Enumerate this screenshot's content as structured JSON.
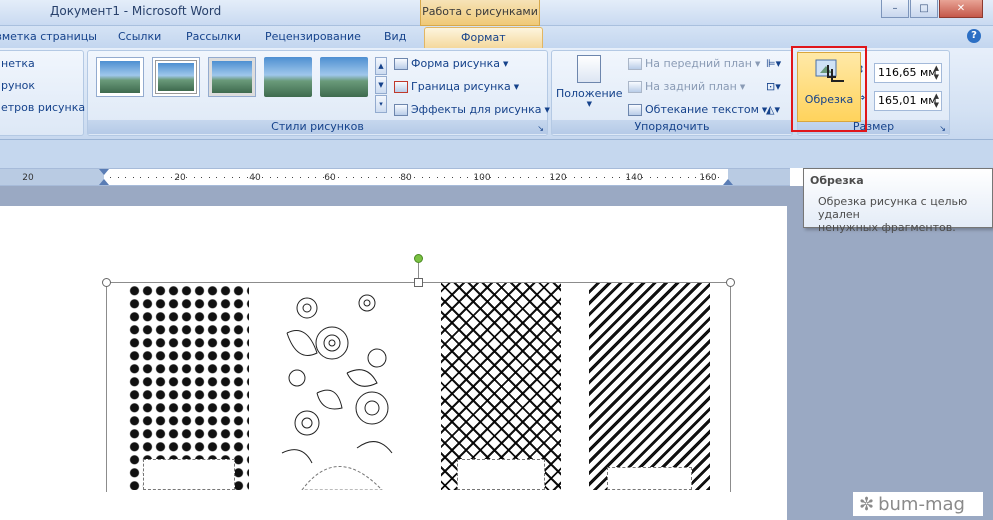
{
  "titlebar": {
    "title": "Документ1 - Microsoft Word",
    "context_tab": "Работа с рисунками",
    "minimize": "–",
    "maximize": "□",
    "close": "✕"
  },
  "tabs": {
    "items": [
      "зметка страницы",
      "Ссылки",
      "Рассылки",
      "Рецензирование",
      "Вид"
    ],
    "active": "Формат",
    "help": "?"
  },
  "ribbon": {
    "left_items": [
      "нетка",
      "рунок",
      "етров рисунка"
    ],
    "styles_group": {
      "label": "Стили рисунков",
      "shape": "Форма рисунка",
      "border": "Граница рисунка",
      "effects": "Эффекты для рисунка"
    },
    "arrange_group": {
      "label": "Упорядочить",
      "position": "Положение",
      "front": "На передний план",
      "back": "На задний план",
      "wrap": "Обтекание текстом"
    },
    "size_group": {
      "label": "Размер",
      "crop": "Обрезка",
      "height": "116,65 мм",
      "width": "165,01 мм"
    }
  },
  "ruler": {
    "labels": [
      "20",
      "20",
      "40",
      "60",
      "80",
      "100",
      "120",
      "140",
      "160"
    ]
  },
  "tooltip": {
    "title": "Обрезка",
    "body_line1": "Обрезка рисунка с целью удален",
    "body_line2": "ненужных фрагментов."
  },
  "watermark": "bum-mag"
}
